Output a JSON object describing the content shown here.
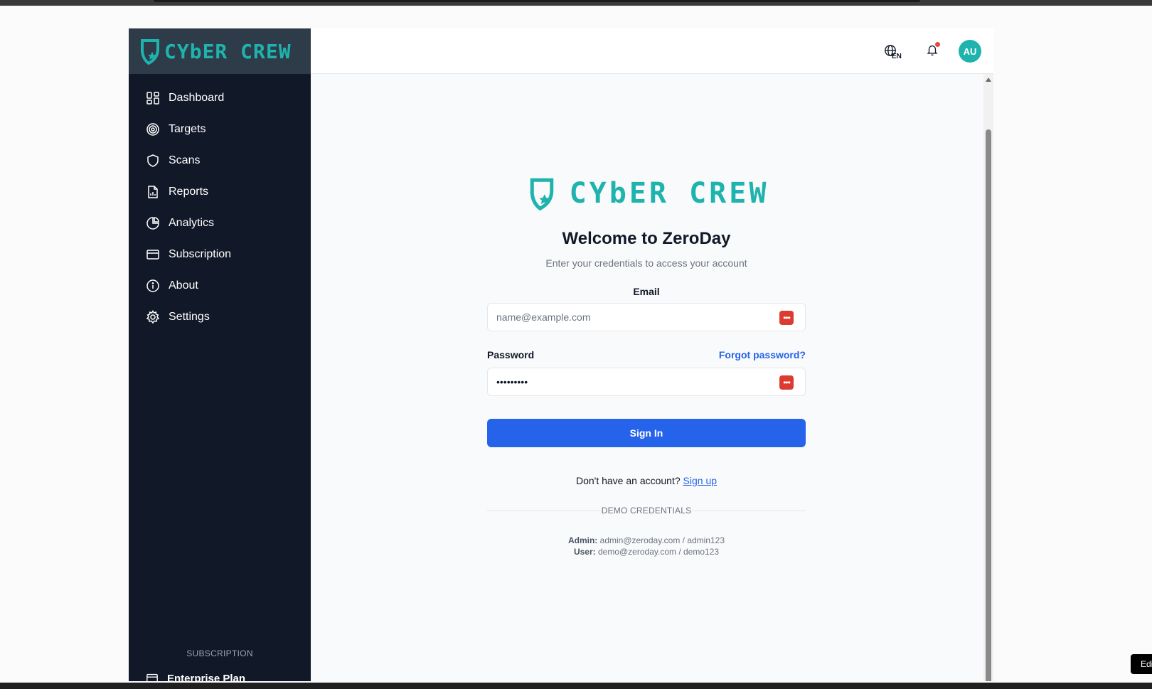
{
  "brand": {
    "name": "CYbER CREW",
    "color": "#1fb3ad"
  },
  "sidebar": {
    "items": [
      {
        "label": "Dashboard",
        "icon": "dashboard-icon"
      },
      {
        "label": "Targets",
        "icon": "target-icon"
      },
      {
        "label": "Scans",
        "icon": "shield-icon"
      },
      {
        "label": "Reports",
        "icon": "report-icon"
      },
      {
        "label": "Analytics",
        "icon": "pie-chart-icon"
      },
      {
        "label": "Subscription",
        "icon": "credit-card-icon"
      },
      {
        "label": "About",
        "icon": "info-icon"
      },
      {
        "label": "Settings",
        "icon": "gear-icon"
      }
    ],
    "subscription_title": "SUBSCRIPTION",
    "plan_name": "Enterprise Plan"
  },
  "header": {
    "language_code": "EN",
    "avatar_initials": "AU",
    "notification_color": "#ef4444"
  },
  "login": {
    "title": "Welcome to ZeroDay",
    "subtitle": "Enter your credentials to access your account",
    "email_label": "Email",
    "email_placeholder": "name@example.com",
    "password_label": "Password",
    "password_value": "•••••••••",
    "forgot_label": "Forgot password?",
    "signin_label": "Sign In",
    "no_account_text": "Don't have an account?",
    "signup_label": "Sign up",
    "demo_title": "DEMO CREDENTIALS",
    "admin_label": "Admin:",
    "admin_creds": "admin@zeroday.com / admin123",
    "user_label": "User:",
    "user_creds": "demo@zeroday.com / demo123",
    "button_color": "#2563eb"
  },
  "edit_chip": "Edi"
}
